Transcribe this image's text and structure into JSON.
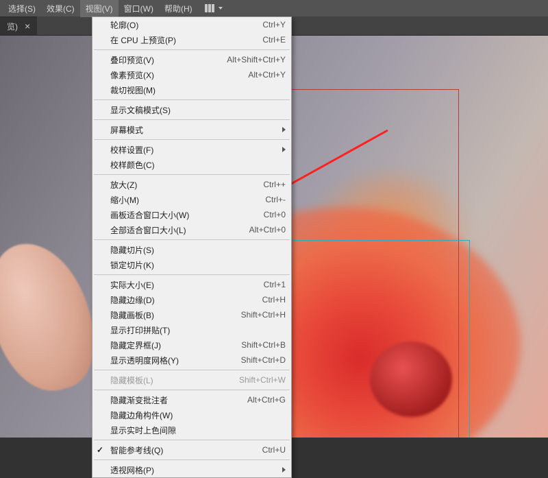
{
  "menubar": {
    "items": [
      "选择(S)",
      "效果(C)",
      "视图(V)",
      "窗口(W)",
      "帮助(H)"
    ],
    "activeIndex": 2
  },
  "tab": {
    "label": "览)",
    "close": "×"
  },
  "dropdown": {
    "sections": [
      [
        {
          "label": "轮廓(O)",
          "shortcut": "Ctrl+Y"
        },
        {
          "label": "在 CPU 上预览(P)",
          "shortcut": "Ctrl+E"
        }
      ],
      [
        {
          "label": "叠印预览(V)",
          "shortcut": "Alt+Shift+Ctrl+Y"
        },
        {
          "label": "像素预览(X)",
          "shortcut": "Alt+Ctrl+Y"
        },
        {
          "label": "裁切视图(M)",
          "shortcut": ""
        }
      ],
      [
        {
          "label": "显示文稿模式(S)",
          "shortcut": ""
        }
      ],
      [
        {
          "label": "屏幕模式",
          "shortcut": "",
          "submenu": true
        }
      ],
      [
        {
          "label": "校样设置(F)",
          "shortcut": "",
          "submenu": true
        },
        {
          "label": "校样颜色(C)",
          "shortcut": ""
        }
      ],
      [
        {
          "label": "放大(Z)",
          "shortcut": "Ctrl++"
        },
        {
          "label": "缩小(M)",
          "shortcut": "Ctrl+-"
        },
        {
          "label": "画板适合窗口大小(W)",
          "shortcut": "Ctrl+0"
        },
        {
          "label": "全部适合窗口大小(L)",
          "shortcut": "Alt+Ctrl+0"
        }
      ],
      [
        {
          "label": "隐藏切片(S)",
          "shortcut": ""
        },
        {
          "label": "锁定切片(K)",
          "shortcut": ""
        }
      ],
      [
        {
          "label": "实际大小(E)",
          "shortcut": "Ctrl+1"
        },
        {
          "label": "隐藏边缘(D)",
          "shortcut": "Ctrl+H"
        },
        {
          "label": "隐藏画板(B)",
          "shortcut": "Shift+Ctrl+H"
        },
        {
          "label": "显示打印拼贴(T)",
          "shortcut": ""
        },
        {
          "label": "隐藏定界框(J)",
          "shortcut": "Shift+Ctrl+B"
        },
        {
          "label": "显示透明度网格(Y)",
          "shortcut": "Shift+Ctrl+D"
        }
      ],
      [
        {
          "label": "隐藏模板(L)",
          "shortcut": "Shift+Ctrl+W",
          "disabled": true
        }
      ],
      [
        {
          "label": "隐藏渐变批注者",
          "shortcut": "Alt+Ctrl+G"
        },
        {
          "label": "隐藏边角构件(W)",
          "shortcut": ""
        },
        {
          "label": "显示实时上色间隙",
          "shortcut": ""
        }
      ],
      [
        {
          "label": "智能参考线(Q)",
          "shortcut": "Ctrl+U",
          "checked": true
        }
      ],
      [
        {
          "label": "透视网格(P)",
          "shortcut": "",
          "submenu": true
        }
      ]
    ]
  }
}
